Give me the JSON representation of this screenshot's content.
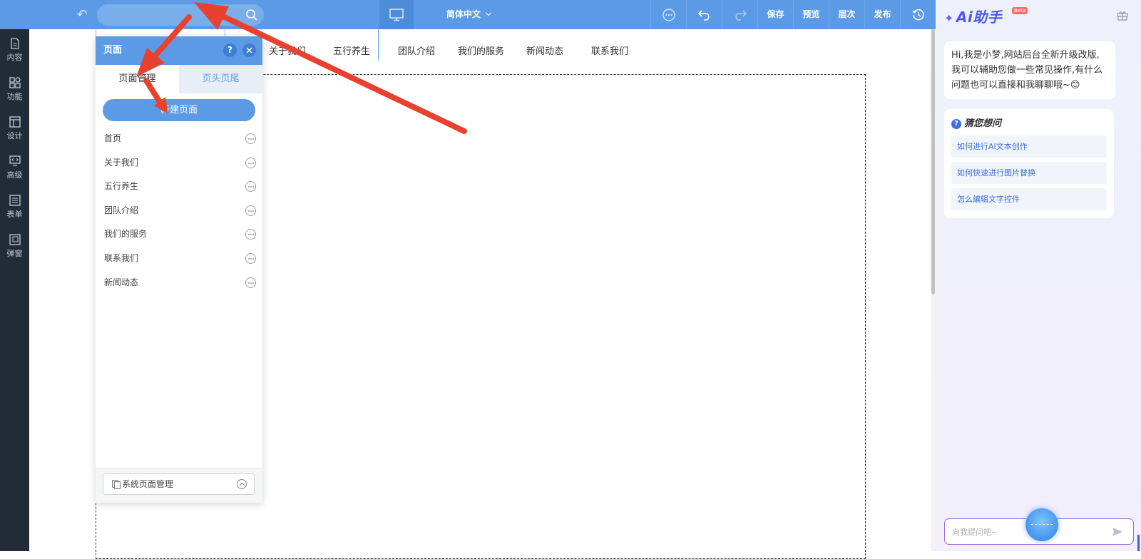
{
  "toolbar": {
    "language": "简体中文",
    "save": "保存",
    "preview": "预览",
    "layers": "层次",
    "publish": "发布"
  },
  "rail": {
    "items": [
      {
        "label": "内容",
        "icon": "document-icon"
      },
      {
        "label": "功能",
        "icon": "grid-icon"
      },
      {
        "label": "设计",
        "icon": "layout-icon"
      },
      {
        "label": "高级",
        "icon": "code-monitor-icon"
      },
      {
        "label": "表单",
        "icon": "form-icon"
      },
      {
        "label": "弹窗",
        "icon": "popup-icon"
      }
    ]
  },
  "site_nav": [
    "关于我们",
    "五行养生",
    "团队介绍",
    "我们的服务",
    "新闻动态",
    "联系我们"
  ],
  "panel": {
    "title": "页面",
    "help": "?",
    "tabs": [
      "页面管理",
      "页头页尾"
    ],
    "new_page": "新建页面",
    "pages": [
      "首页",
      "关于我们",
      "五行养生",
      "团队介绍",
      "我们的服务",
      "联系我们",
      "新闻动态"
    ],
    "system_pages": "系统页面管理"
  },
  "ai": {
    "title": "Ai助手",
    "badge": "Beta",
    "greeting": "Hi,我是小梦,网站后台全新升级改版,我可以辅助您做一些常见操作,有什么问题也可以直接和我聊聊哦~😊",
    "guess_title": "猜您想问",
    "questions": [
      "如何进行AI文本创作",
      "如何快速进行图片替换",
      "怎么编辑文字控件"
    ],
    "input_placeholder": "向我提问吧~"
  },
  "colors": {
    "topbar": "#5b9be6",
    "rail": "#222b38",
    "accent": "#5b9be6",
    "annotation_arrow": "#e8412f"
  }
}
